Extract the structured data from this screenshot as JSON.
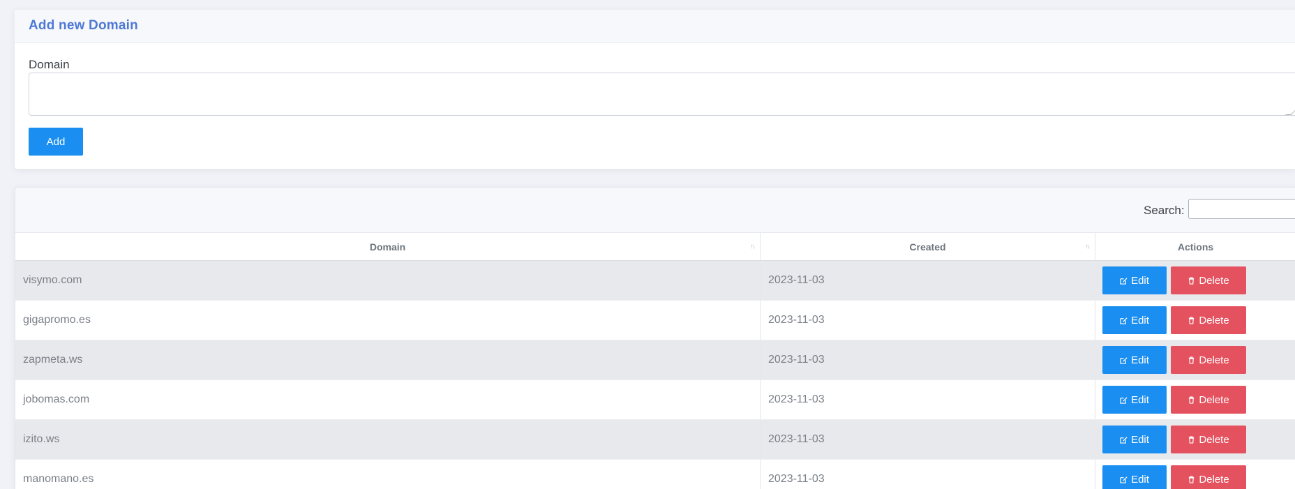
{
  "add_card": {
    "title": "Add new Domain",
    "field_label": "Domain",
    "field_value": "",
    "add_button": "Add"
  },
  "table_card": {
    "search_label": "Search:",
    "search_value": "",
    "columns": [
      "Domain",
      "Created",
      "Actions"
    ],
    "edit_label": "Edit",
    "delete_label": "Delete",
    "rows": [
      {
        "domain": "visymo.com",
        "created": "2023-11-03"
      },
      {
        "domain": "gigapromo.es",
        "created": "2023-11-03"
      },
      {
        "domain": "zapmeta.ws",
        "created": "2023-11-03"
      },
      {
        "domain": "jobomas.com",
        "created": "2023-11-03"
      },
      {
        "domain": "izito.ws",
        "created": "2023-11-03"
      },
      {
        "domain": "manomano.es",
        "created": "2023-11-03"
      }
    ]
  },
  "icons": {
    "edit": "edit-icon",
    "delete": "trash-icon",
    "sort": "sort-icon"
  },
  "colors": {
    "title": "#4d79d5",
    "primary": "#1a8ef1",
    "danger": "#e5525f",
    "row_striped": "#e8e9ec"
  }
}
